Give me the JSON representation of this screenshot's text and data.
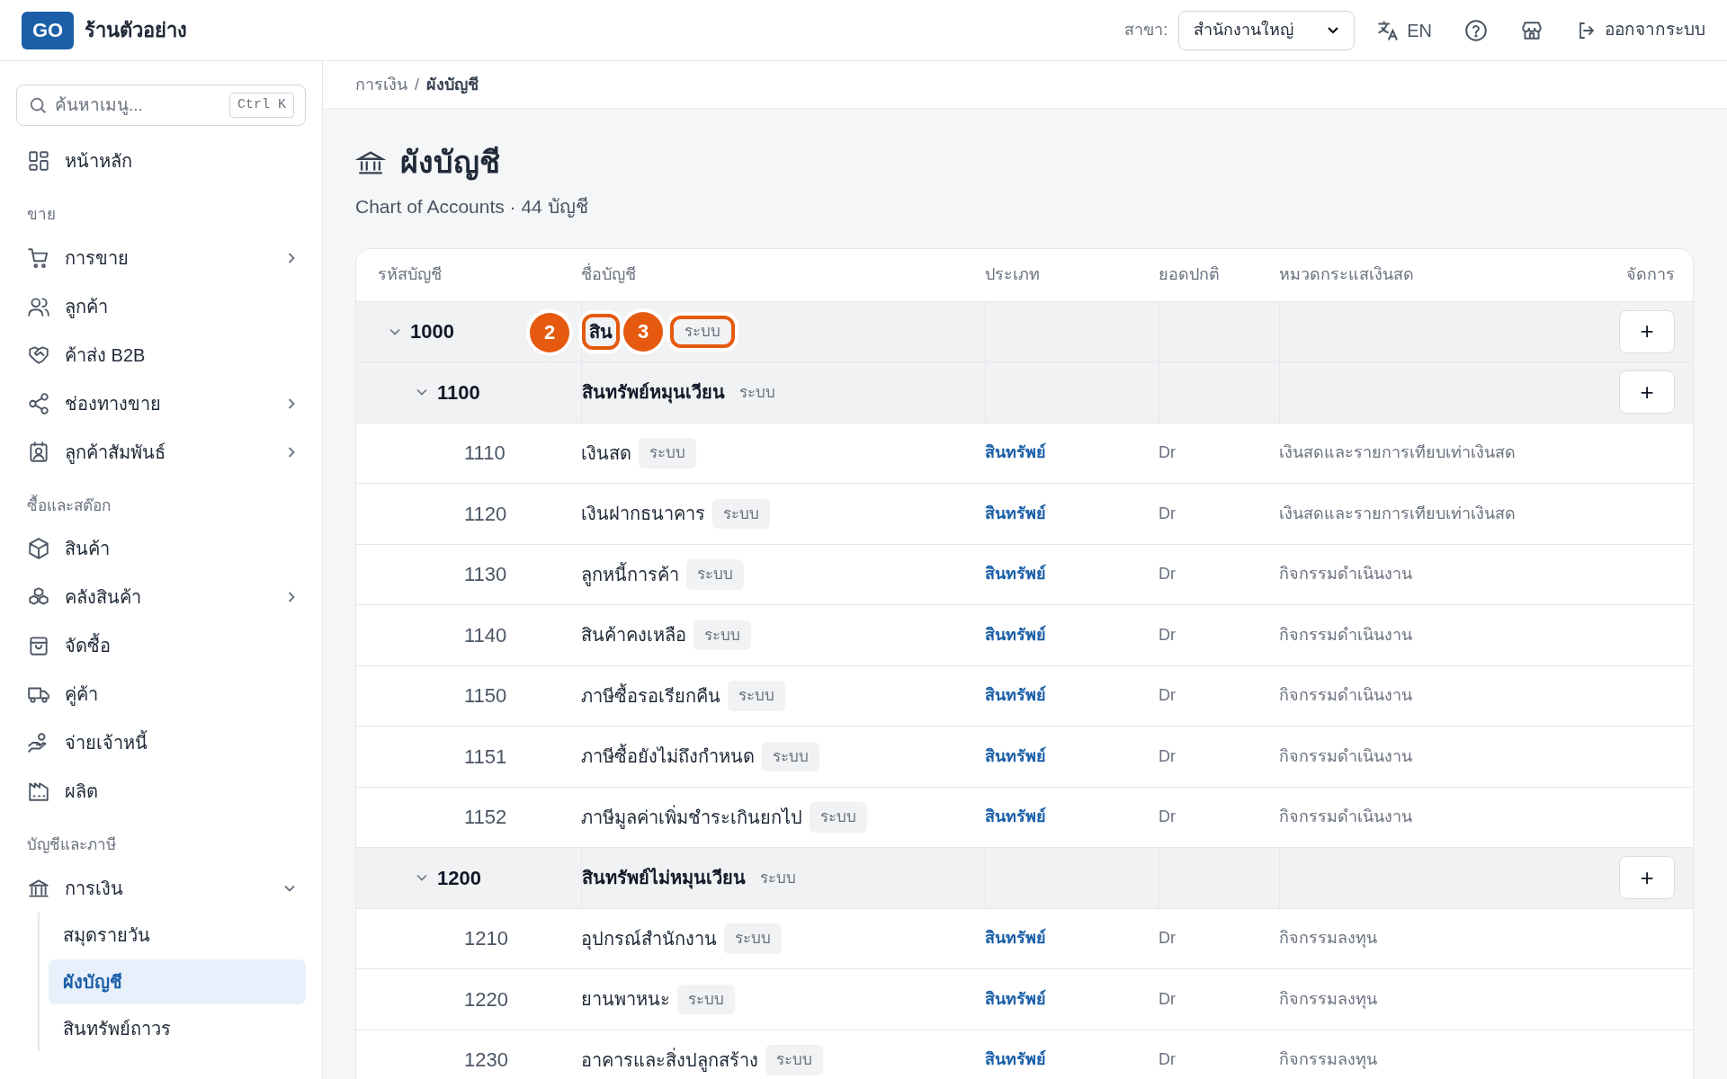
{
  "header": {
    "logo": "GO",
    "shop_name": "ร้านตัวอย่าง",
    "branch_label": "สาขา:",
    "branch": "สำนักงานใหญ่",
    "language": "EN",
    "logout": "ออกจากระบบ"
  },
  "sidebar": {
    "search": {
      "placeholder": "ค้นหาเมนู...",
      "shortcut": "Ctrl K"
    },
    "sections": [
      {
        "items": [
          {
            "label": "หน้าหลัก",
            "kind": "link"
          }
        ]
      },
      {
        "heading": "ขาย",
        "items": [
          {
            "label": "การขาย",
            "kind": "group",
            "expanded": false
          },
          {
            "label": "ลูกค้า",
            "kind": "link"
          },
          {
            "label": "ค้าส่ง B2B",
            "kind": "link"
          },
          {
            "label": "ช่องทางขาย",
            "kind": "group",
            "expanded": false
          },
          {
            "label": "ลูกค้าสัมพันธ์",
            "kind": "group",
            "expanded": false
          }
        ]
      },
      {
        "heading": "ซื้อและสต๊อก",
        "items": [
          {
            "label": "สินค้า",
            "kind": "link"
          },
          {
            "label": "คลังสินค้า",
            "kind": "group",
            "expanded": false
          },
          {
            "label": "จัดซื้อ",
            "kind": "link"
          },
          {
            "label": "คู่ค้า",
            "kind": "link"
          },
          {
            "label": "จ่ายเจ้าหนี้",
            "kind": "link"
          },
          {
            "label": "ผลิต",
            "kind": "link"
          }
        ]
      },
      {
        "heading": "บัญชีและภาษี",
        "items": [
          {
            "label": "การเงิน",
            "kind": "group",
            "expanded": true,
            "children": [
              {
                "label": "สมุดรายวัน",
                "selected": false
              },
              {
                "label": "ผังบัญชี",
                "selected": true
              },
              {
                "label": "สินทรัพย์ถาวร",
                "selected": false
              }
            ]
          }
        ]
      }
    ]
  },
  "breadcrumb": {
    "items": [
      "การเงิน",
      "ผังบัญชี"
    ],
    "separator": "/"
  },
  "page": {
    "title": "ผังบัญชี",
    "subtitle": "Chart of Accounts · 44 บัญชี"
  },
  "table": {
    "columns": [
      "รหัสบัญชี",
      "ชื่อบัญชี",
      "ประเภท",
      "ยอดปกติ",
      "หมวดกระแสเงินสด",
      "จัดการ"
    ],
    "rows": [
      {
        "kind": "group",
        "code": "1000",
        "name": "สิน",
        "badge": "ระบบ",
        "expanded": true,
        "add": "+",
        "name_highlighted": true,
        "badge_highlighted": true,
        "callouts": [
          "2",
          "3"
        ],
        "children": [
          {
            "kind": "group",
            "code": "1100",
            "name": "สินทรัพย์หมุนเวียน",
            "badge": "ระบบ",
            "expanded": true,
            "add": "+",
            "children": [
              {
                "kind": "account",
                "code": "1110",
                "name": "เงินสด",
                "badge": "ระบบ",
                "type": "สินทรัพย์",
                "normal": "Dr",
                "cash_flow": "เงินสดและรายการเทียบเท่าเงินสด"
              },
              {
                "kind": "account",
                "code": "1120",
                "name": "เงินฝากธนาคาร",
                "badge": "ระบบ",
                "type": "สินทรัพย์",
                "normal": "Dr",
                "cash_flow": "เงินสดและรายการเทียบเท่าเงินสด"
              },
              {
                "kind": "account",
                "code": "1130",
                "name": "ลูกหนี้การค้า",
                "badge": "ระบบ",
                "type": "สินทรัพย์",
                "normal": "Dr",
                "cash_flow": "กิจกรรมดำเนินงาน"
              },
              {
                "kind": "account",
                "code": "1140",
                "name": "สินค้าคงเหลือ",
                "badge": "ระบบ",
                "type": "สินทรัพย์",
                "normal": "Dr",
                "cash_flow": "กิจกรรมดำเนินงาน"
              },
              {
                "kind": "account",
                "code": "1150",
                "name": "ภาษีซื้อรอเรียกคืน",
                "badge": "ระบบ",
                "type": "สินทรัพย์",
                "normal": "Dr",
                "cash_flow": "กิจกรรมดำเนินงาน"
              },
              {
                "kind": "account",
                "code": "1151",
                "name": "ภาษีซื้อยังไม่ถึงกำหนด",
                "badge": "ระบบ",
                "type": "สินทรัพย์",
                "normal": "Dr",
                "cash_flow": "กิจกรรมดำเนินงาน"
              },
              {
                "kind": "account",
                "code": "1152",
                "name": "ภาษีมูลค่าเพิ่มชำระเกินยกไป",
                "badge": "ระบบ",
                "type": "สินทรัพย์",
                "normal": "Dr",
                "cash_flow": "กิจกรรมดำเนินงาน"
              }
            ]
          },
          {
            "kind": "group",
            "code": "1200",
            "name": "สินทรัพย์ไม่หมุนเวียน",
            "badge": "ระบบ",
            "expanded": true,
            "add": "+",
            "children": [
              {
                "kind": "account",
                "code": "1210",
                "name": "อุปกรณ์สำนักงาน",
                "badge": "ระบบ",
                "type": "สินทรัพย์",
                "normal": "Dr",
                "cash_flow": "กิจกรรมลงทุน"
              },
              {
                "kind": "account",
                "code": "1220",
                "name": "ยานพาหนะ",
                "badge": "ระบบ",
                "type": "สินทรัพย์",
                "normal": "Dr",
                "cash_flow": "กิจกรรมลงทุน"
              },
              {
                "kind": "account",
                "code": "1230",
                "name": "อาคารและสิ่งปลูกสร้าง",
                "badge": "ระบบ",
                "type": "สินทรัพย์",
                "normal": "Dr",
                "cash_flow": "กิจกรรมลงทุน"
              }
            ]
          }
        ]
      }
    ]
  }
}
